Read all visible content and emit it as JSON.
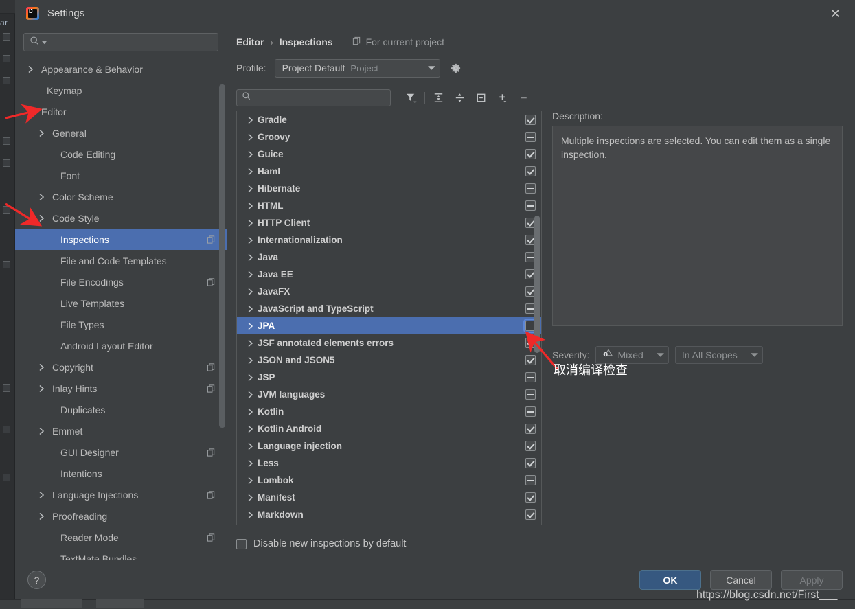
{
  "window": {
    "title": "Settings",
    "logo_text": "IJ",
    "close_icon": "close-icon"
  },
  "background": {
    "left_label": "ar"
  },
  "sidebar": {
    "search_placeholder": "",
    "search_value": "",
    "items": [
      {
        "label": "Appearance & Behavior",
        "indent": 0,
        "chevron": "right",
        "badge": false,
        "selected": false
      },
      {
        "label": "Keymap",
        "indent": 1,
        "chevron": "none",
        "badge": false,
        "selected": false
      },
      {
        "label": "Editor",
        "indent": 0,
        "chevron": "down",
        "badge": false,
        "selected": false
      },
      {
        "label": "General",
        "indent": 1,
        "chevron": "right",
        "badge": false,
        "selected": false
      },
      {
        "label": "Code Editing",
        "indent": 2,
        "chevron": "none",
        "badge": false,
        "selected": false
      },
      {
        "label": "Font",
        "indent": 2,
        "chevron": "none",
        "badge": false,
        "selected": false
      },
      {
        "label": "Color Scheme",
        "indent": 1,
        "chevron": "right",
        "badge": false,
        "selected": false
      },
      {
        "label": "Code Style",
        "indent": 1,
        "chevron": "right",
        "badge": false,
        "selected": false
      },
      {
        "label": "Inspections",
        "indent": 2,
        "chevron": "none",
        "badge": true,
        "selected": true
      },
      {
        "label": "File and Code Templates",
        "indent": 2,
        "chevron": "none",
        "badge": false,
        "selected": false
      },
      {
        "label": "File Encodings",
        "indent": 2,
        "chevron": "none",
        "badge": true,
        "selected": false
      },
      {
        "label": "Live Templates",
        "indent": 2,
        "chevron": "none",
        "badge": false,
        "selected": false
      },
      {
        "label": "File Types",
        "indent": 2,
        "chevron": "none",
        "badge": false,
        "selected": false
      },
      {
        "label": "Android Layout Editor",
        "indent": 2,
        "chevron": "none",
        "badge": false,
        "selected": false
      },
      {
        "label": "Copyright",
        "indent": 1,
        "chevron": "right",
        "badge": true,
        "selected": false
      },
      {
        "label": "Inlay Hints",
        "indent": 1,
        "chevron": "right",
        "badge": true,
        "selected": false
      },
      {
        "label": "Duplicates",
        "indent": 2,
        "chevron": "none",
        "badge": false,
        "selected": false
      },
      {
        "label": "Emmet",
        "indent": 1,
        "chevron": "right",
        "badge": false,
        "selected": false
      },
      {
        "label": "GUI Designer",
        "indent": 2,
        "chevron": "none",
        "badge": true,
        "selected": false
      },
      {
        "label": "Intentions",
        "indent": 2,
        "chevron": "none",
        "badge": false,
        "selected": false
      },
      {
        "label": "Language Injections",
        "indent": 1,
        "chevron": "right",
        "badge": true,
        "selected": false
      },
      {
        "label": "Proofreading",
        "indent": 1,
        "chevron": "right",
        "badge": false,
        "selected": false
      },
      {
        "label": "Reader Mode",
        "indent": 2,
        "chevron": "none",
        "badge": true,
        "selected": false
      },
      {
        "label": "TextMate Bundles",
        "indent": 2,
        "chevron": "none",
        "badge": false,
        "selected": false
      }
    ]
  },
  "main": {
    "breadcrumb": {
      "parent": "Editor",
      "separator": "›",
      "current": "Inspections"
    },
    "scope_note": {
      "icon": "copy-icon",
      "text": "For current project"
    },
    "profile": {
      "label": "Profile:",
      "value": "Project Default",
      "value_suffix": "Project",
      "dropdown_icon": "chevron-down-icon",
      "gear_icon": "gear-icon"
    },
    "toolbar": {
      "search_placeholder": "",
      "search_value": "",
      "buttons": [
        {
          "name": "filter-icon",
          "title": "Filter"
        },
        {
          "name": "expand-all-icon",
          "title": "Expand All"
        },
        {
          "name": "collapse-all-icon",
          "title": "Collapse All"
        },
        {
          "name": "collapse-node-icon",
          "title": "Collapse Node"
        },
        {
          "name": "add-icon",
          "title": "Add"
        },
        {
          "name": "remove-icon",
          "title": "Remove"
        }
      ]
    },
    "inspections": [
      {
        "name": "Gradle",
        "state": "checked",
        "selected": false
      },
      {
        "name": "Groovy",
        "state": "partial",
        "selected": false
      },
      {
        "name": "Guice",
        "state": "checked",
        "selected": false
      },
      {
        "name": "Haml",
        "state": "checked",
        "selected": false
      },
      {
        "name": "Hibernate",
        "state": "partial",
        "selected": false
      },
      {
        "name": "HTML",
        "state": "partial",
        "selected": false
      },
      {
        "name": "HTTP Client",
        "state": "checked",
        "selected": false
      },
      {
        "name": "Internationalization",
        "state": "checked",
        "selected": false
      },
      {
        "name": "Java",
        "state": "partial",
        "selected": false
      },
      {
        "name": "Java EE",
        "state": "checked",
        "selected": false
      },
      {
        "name": "JavaFX",
        "state": "checked",
        "selected": false
      },
      {
        "name": "JavaScript and TypeScript",
        "state": "partial",
        "selected": false
      },
      {
        "name": "JPA",
        "state": "empty",
        "selected": true
      },
      {
        "name": "JSF annotated elements errors",
        "state": "checked",
        "selected": false
      },
      {
        "name": "JSON and JSON5",
        "state": "checked",
        "selected": false
      },
      {
        "name": "JSP",
        "state": "partial",
        "selected": false
      },
      {
        "name": "JVM languages",
        "state": "partial",
        "selected": false
      },
      {
        "name": "Kotlin",
        "state": "partial",
        "selected": false
      },
      {
        "name": "Kotlin Android",
        "state": "checked",
        "selected": false
      },
      {
        "name": "Language injection",
        "state": "checked",
        "selected": false
      },
      {
        "name": "Less",
        "state": "checked",
        "selected": false
      },
      {
        "name": "Lombok",
        "state": "partial",
        "selected": false
      },
      {
        "name": "Manifest",
        "state": "checked",
        "selected": false
      },
      {
        "name": "Markdown",
        "state": "checked",
        "selected": false
      }
    ],
    "description": {
      "label": "Description:",
      "text": "Multiple inspections are selected. You can edit them as a single inspection."
    },
    "severity": {
      "label": "Severity:",
      "value": "Mixed",
      "icon": "severity-mixed-icon",
      "scope_value": "In All Scopes",
      "dropdown_icon": "chevron-down-icon"
    },
    "disable_new": {
      "label": "Disable new inspections by default",
      "checked": false
    }
  },
  "footer": {
    "help_label": "?",
    "ok_label": "OK",
    "cancel_label": "Cancel",
    "apply_label": "Apply"
  },
  "annotations": {
    "note_text": "取消编译检查",
    "watermark": "https://blog.csdn.net/First___",
    "arrow_color": "#ef2929"
  }
}
